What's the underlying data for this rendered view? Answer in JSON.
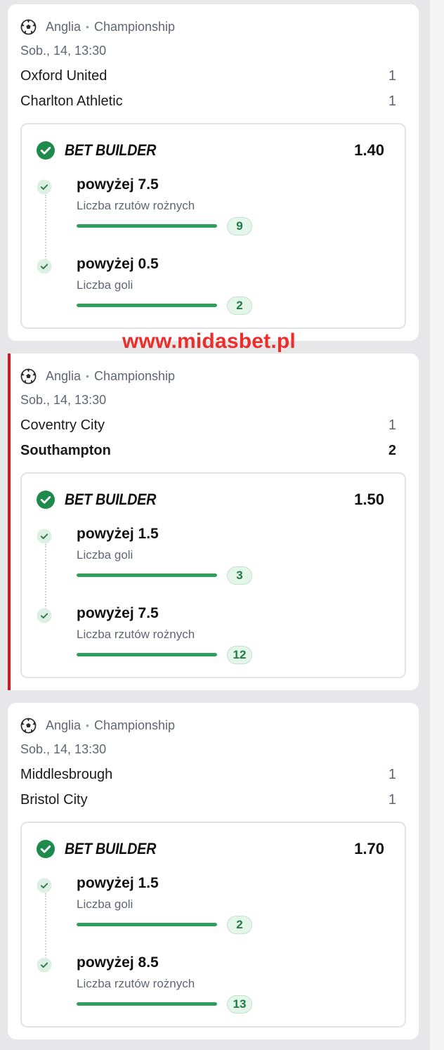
{
  "watermark": "www.midasbet.pl",
  "colors": {
    "accent_red": "#d8141d",
    "success_green": "#1e8a4c",
    "bar_green": "#2f9e5c"
  },
  "matches": [
    {
      "league": {
        "country": "Anglia",
        "competition": "Championship",
        "icon": "soccer-ball-icon"
      },
      "datetime": "Sob., 14, 13:30",
      "home": {
        "name": "Oxford United",
        "score": "1"
      },
      "away": {
        "name": "Charlton Athletic",
        "score": "1"
      },
      "winner": "",
      "bet_builder": {
        "title": "BET BUILDER",
        "odds": "1.40",
        "selections": [
          {
            "name": "powyżej 7.5",
            "market": "Liczba rzutów rożnych",
            "value": "9",
            "progress": 1.0
          },
          {
            "name": "powyżej 0.5",
            "market": "Liczba goli",
            "value": "2",
            "progress": 1.0
          }
        ]
      }
    },
    {
      "league": {
        "country": "Anglia",
        "competition": "Championship",
        "icon": "soccer-ball-icon"
      },
      "datetime": "Sob., 14, 13:30",
      "home": {
        "name": "Coventry City",
        "score": "1"
      },
      "away": {
        "name": "Southampton",
        "score": "2"
      },
      "winner": "away",
      "bet_builder": {
        "title": "BET BUILDER",
        "odds": "1.50",
        "selections": [
          {
            "name": "powyżej 1.5",
            "market": "Liczba goli",
            "value": "3",
            "progress": 1.0
          },
          {
            "name": "powyżej 7.5",
            "market": "Liczba rzutów rożnych",
            "value": "12",
            "progress": 1.0
          }
        ]
      }
    },
    {
      "league": {
        "country": "Anglia",
        "competition": "Championship",
        "icon": "soccer-ball-icon"
      },
      "datetime": "Sob., 14, 13:30",
      "home": {
        "name": "Middlesbrough",
        "score": "1"
      },
      "away": {
        "name": "Bristol City",
        "score": "1"
      },
      "winner": "",
      "bet_builder": {
        "title": "BET BUILDER",
        "odds": "1.70",
        "selections": [
          {
            "name": "powyżej 1.5",
            "market": "Liczba goli",
            "value": "2",
            "progress": 1.0
          },
          {
            "name": "powyżej 8.5",
            "market": "Liczba rzutów rożnych",
            "value": "13",
            "progress": 1.0
          }
        ]
      }
    }
  ]
}
